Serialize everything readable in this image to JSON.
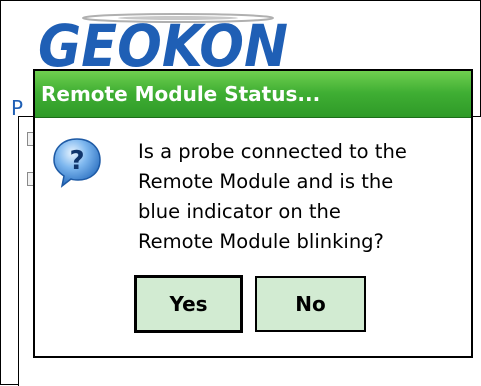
{
  "background": {
    "logo_text": "GEOKON",
    "partial_label": "P"
  },
  "dialog": {
    "title": "Remote Module Status...",
    "icon": "question-icon",
    "message": "Is a probe connected to the Remote Module and is the blue indicator on the Remote Module blinking?",
    "message_lines": [
      "Is a probe connected to the",
      "Remote Module and is the",
      "blue indicator on the",
      "Remote Module blinking?"
    ],
    "buttons": {
      "yes_label": "Yes",
      "no_label": "No"
    }
  },
  "colors": {
    "titlebar": "#3fae33",
    "button_fill": "#d2ebd2",
    "logo_blue": "#1f5fb5"
  }
}
